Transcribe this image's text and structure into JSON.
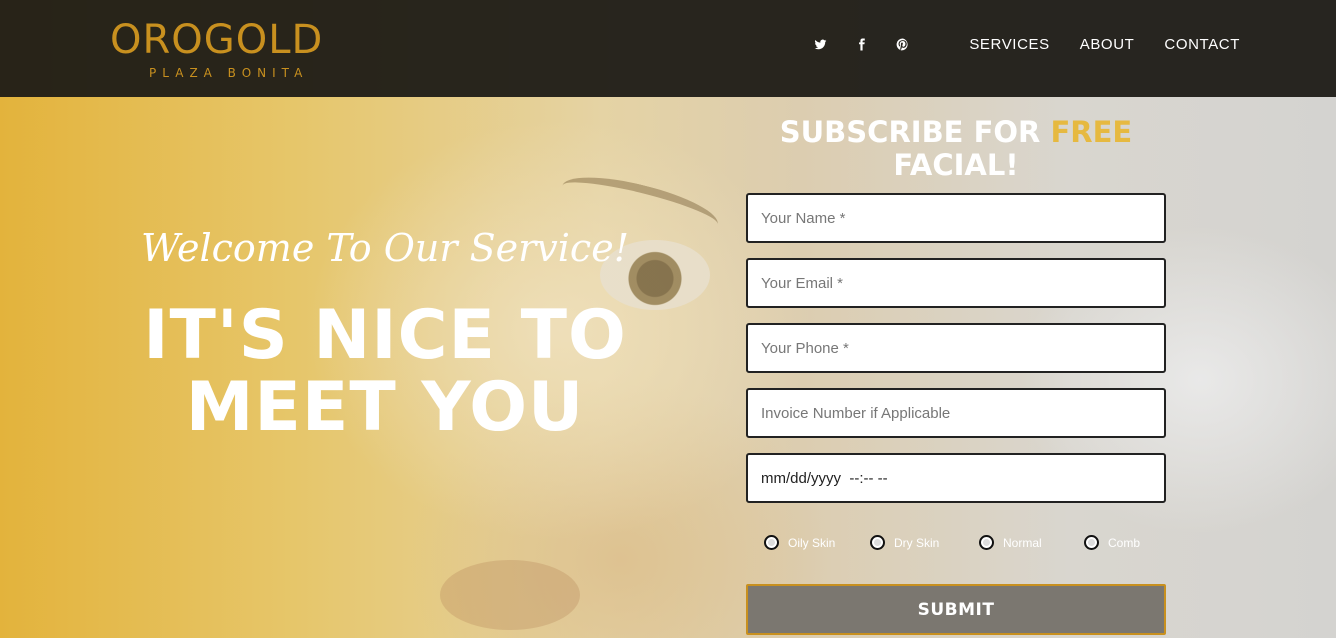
{
  "header": {
    "brand": "OROGOLD",
    "brand_sub": "PLAZA BONITA",
    "social": [
      {
        "icon": "twitter-icon"
      },
      {
        "icon": "facebook-icon"
      },
      {
        "icon": "pinterest-icon"
      }
    ],
    "nav": [
      "SERVICES",
      "ABOUT",
      "CONTACT"
    ]
  },
  "hero": {
    "welcome": "Welcome To Our Service!",
    "headline_line1": "IT'S NICE TO",
    "headline_line2": "MEET YOU"
  },
  "form": {
    "title_part1": "SUBSCRIBE FOR ",
    "title_accent": "FREE",
    "title_part2": "FACIAL!",
    "name_placeholder": "Your Name *",
    "email_placeholder": "Your Email *",
    "phone_placeholder": "Your Phone *",
    "invoice_placeholder": "Invoice Number if Applicable",
    "datetime_value": "mm/dd/yyyy  --:-- --",
    "skin_options": [
      "Oily Skin",
      "Dry Skin",
      "Normal",
      "Comb"
    ],
    "submit_label": "SUBMIT"
  },
  "colors": {
    "accent": "#e6b940",
    "logo": "#c8901f",
    "header_bg": "#1e1b16",
    "submit_bg": "#7b7770"
  }
}
